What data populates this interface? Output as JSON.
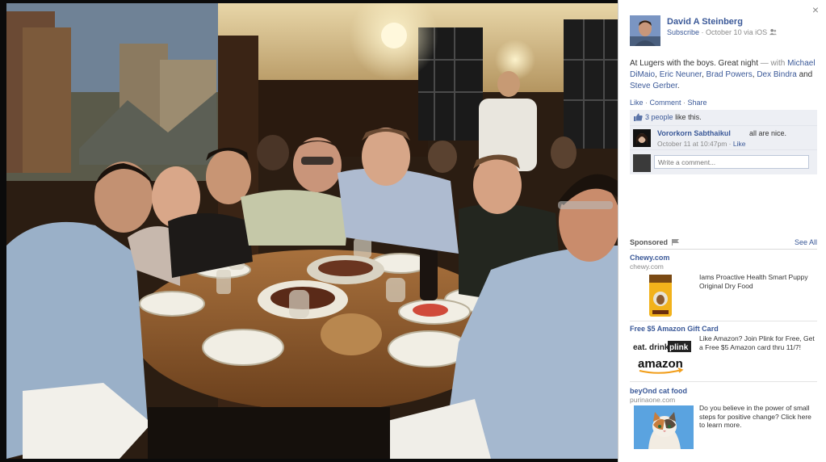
{
  "window": {
    "close_glyph": "×"
  },
  "post": {
    "author": "David A Steinberg",
    "subscribe": "Subscribe",
    "meta": "· October 10 via iOS",
    "caption_text": "At Lugers with the boys. Great night",
    "caption_with": "— with",
    "tagged": [
      "Michael DiMaio",
      "Eric Neuner",
      "Brad Powers",
      "Dex Bindra",
      "Steve Gerber"
    ],
    "tag_sep_1": ",",
    "tag_sep_2": ",",
    "tag_sep_3": ",",
    "tag_and": "and",
    "tag_end": "."
  },
  "actions": {
    "like": "Like",
    "dot1": " · ",
    "comment": "Comment",
    "dot2": " · ",
    "share": "Share"
  },
  "likes": {
    "count_text": "3 people",
    "suffix": "like this."
  },
  "comment": {
    "author": "Vororkorn Sabthaikul",
    "text": "all are nice.",
    "time": "October 11 at 10:47pm",
    "dot": " · ",
    "like": "Like"
  },
  "composer": {
    "placeholder": "Write a comment..."
  },
  "sponsored": {
    "title": "Sponsored",
    "see_all": "See All",
    "ads": [
      {
        "title": "Chewy.com",
        "domain": "chewy.com",
        "body": "Iams Proactive Health Smart Puppy Original Dry Food",
        "icon": "dog-food-bag-image"
      },
      {
        "title": "Free $5 Amazon Gift Card",
        "domain": "",
        "body": "Like Amazon? Join Plink for Free, Get a Free $5 Amazon card thru 11/7!",
        "brand1": "eat. drink.",
        "brand2": "plink",
        "brand3": "amazon",
        "icon": "plink-amazon-logo"
      },
      {
        "title": "beyOnd cat food",
        "domain": "purinaone.com",
        "body": "Do you believe in the power of small steps for positive change? Click here to learn more.",
        "icon": "cat-photo"
      }
    ]
  },
  "icons": {
    "close": "close-icon",
    "audience": "friends-icon",
    "like_thumb": "thumbs-up-icon",
    "ad_flag": "flag-icon"
  },
  "colors": {
    "link": "#3b5998",
    "muted": "#8b8b8b",
    "ufi_bg": "#edeff4"
  }
}
